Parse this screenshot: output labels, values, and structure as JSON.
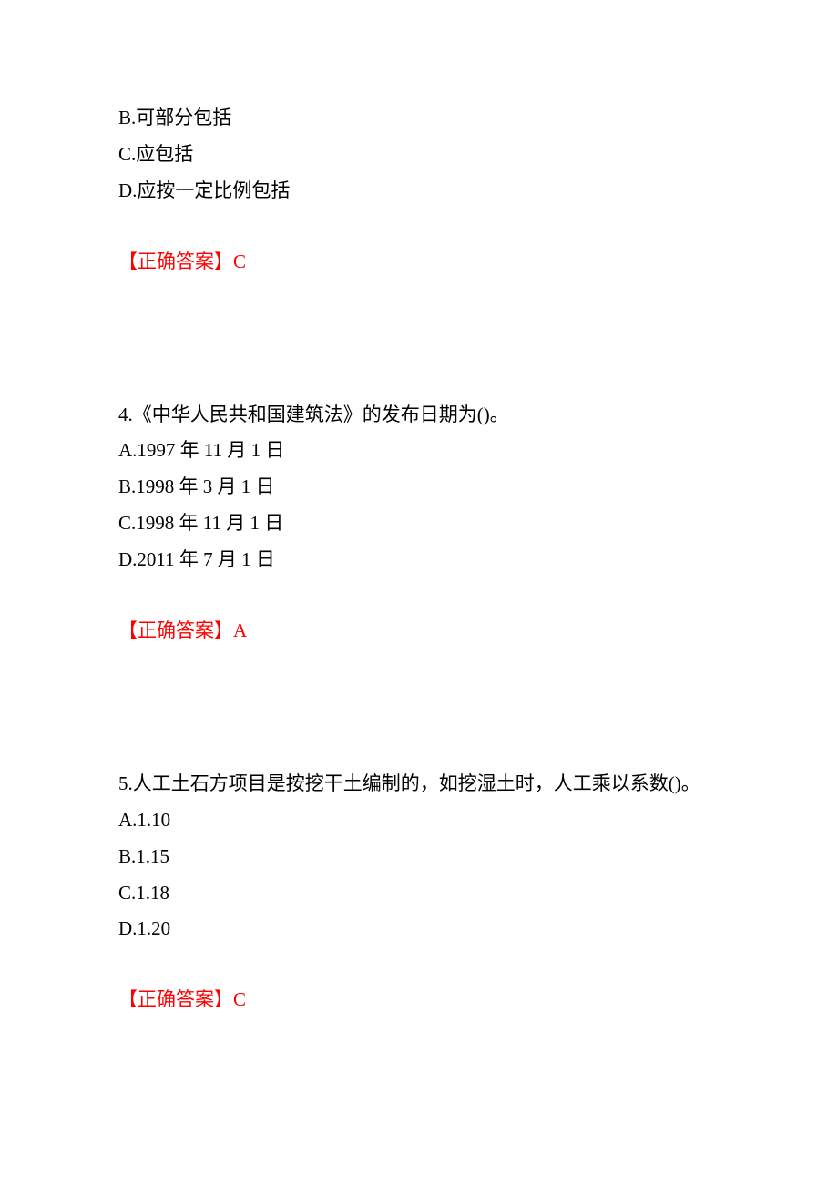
{
  "q3_tail": {
    "option_b": "B.可部分包括",
    "option_c": "C.应包括",
    "option_d": "D.应按一定比例包括",
    "answer": "【正确答案】C"
  },
  "q4": {
    "question": "4.《中华人民共和国建筑法》的发布日期为()。",
    "option_a": "A.1997 年 11 月 1 日",
    "option_b": "B.1998 年 3 月 1 日",
    "option_c": "C.1998 年 11 月 1 日",
    "option_d": "D.2011 年 7 月 1 日",
    "answer": "【正确答案】A"
  },
  "q5": {
    "question": "5.人工土石方项目是按挖干土编制的，如挖湿土时，人工乘以系数()。",
    "option_a": "A.1.10",
    "option_b": "B.1.15",
    "option_c": "C.1.18",
    "option_d": "D.1.20",
    "answer": "【正确答案】C"
  }
}
